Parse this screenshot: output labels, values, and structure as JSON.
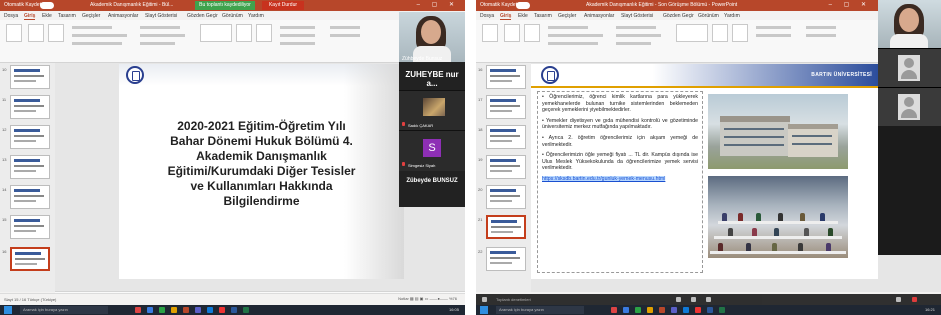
{
  "left_screenshot": {
    "titlebar": {
      "autosave": "Otomatik Kaydet",
      "doc_title": "Akademik Danışmanlık Eğitimi - Bül...",
      "recording_badge": "Bu toplantı kaydediliyor",
      "stop_badge": "Kayıt Durdur"
    },
    "tabs": [
      "Dosya",
      "Giriş",
      "Ekle",
      "Tasarım",
      "Geçişler",
      "Animasyonlar",
      "Slayt Gösterisi",
      "Gözden Geçir",
      "Görünüm",
      "Yardım"
    ],
    "thumb_numbers": [
      "10",
      "11",
      "12",
      "13",
      "14",
      "15",
      "16"
    ],
    "slide_title_lines": [
      "2020-2021 Eğitim-Öğretim Yılı",
      "Bahar Dönemi Hukuk Bölümü 4.",
      "Akademik Danışmanlık",
      "Eğitimi/Kurumdaki Diğer Tesisler",
      "ve Kullanımları Hakkında",
      "Bilgilendirme"
    ],
    "notes_placeholder": "Not eklemek için tıklayın",
    "status_left": "Slayt 15 / 16   Türkçe (Türkiye)",
    "status_right": "Notlar  ▦ ▤ ▣ ▭  ——●——  %76",
    "taskbar_search": "Aramak için buraya yazın",
    "tray_time": "16:05",
    "video_panel": {
      "cam_name": "Zühbeyde Bunsuz",
      "participant_big": "ZUHEYBE nur a...",
      "tile_label_1": "Sadık ÇAKAR",
      "avatar_letter": "S",
      "tile_label_2": "Simgesiz Siyah",
      "presenter_name": "Zübeyde BUNSUZ"
    }
  },
  "right_screenshot": {
    "titlebar": {
      "autosave": "Otomatik Kaydet",
      "doc_title": "Akademik Danışmanlık Eğitimi - Son Görüşme Bölümü - PowerPoint"
    },
    "tabs": [
      "Dosya",
      "Giriş",
      "Ekle",
      "Tasarım",
      "Geçişler",
      "Animasyonlar",
      "Slayt Gösterisi",
      "Gözden Geçir",
      "Görünüm",
      "Yardım"
    ],
    "thumb_numbers": [
      "16",
      "17",
      "18",
      "19",
      "20",
      "21",
      "22"
    ],
    "university_name": "BARTIN ÜNİVERSİTESİ",
    "bullets": [
      "• Öğrencilerimiz, öğrenci kimlik kartlarına para yükleyerek yemekhanelerde bulunan turnike sistemlerinden beklemeden geçerek yemeklerini yiyebilmektedirler.",
      "• Yemekler diyetisyen ve gıda mühendisi kontrolü ve gözetiminde üniversitemiz merkez mutfağında yapılmaktadır.",
      "• Ayrıca 2. öğretim öğrencilerimiz için akşam yemeği de verilmektedir.",
      "• Öğrencilerimizin öğle yemeği fiyatı ... TL dir. Kampüs dışında ise Ulus Meslek Yüksekokulunda da öğrencilerimize yemek servisi verilmektedir."
    ],
    "link_text": "https://sksdb.bartin.edu.tr/gunluk-yemek-menusu.html",
    "control_text": "Toplantı denetimleri",
    "taskbar_search": "Aramak için buraya yazın",
    "tray_time": "16:21"
  },
  "colors": {
    "powerpoint_red": "#b7472a",
    "slide_blue": "#2c4d9c",
    "accent_gold": "#e0a000",
    "avatar_purple": "#8e2fb5"
  }
}
